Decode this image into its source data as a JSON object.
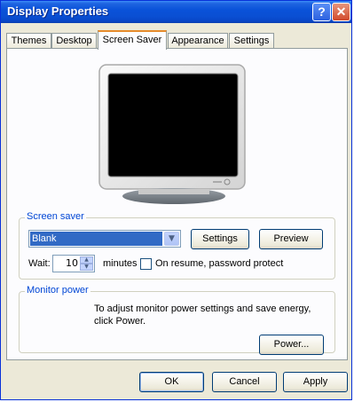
{
  "window": {
    "title": "Display Properties",
    "help_glyph": "?",
    "close_glyph": "✕"
  },
  "tabs": [
    {
      "label": "Themes"
    },
    {
      "label": "Desktop"
    },
    {
      "label": "Screen Saver"
    },
    {
      "label": "Appearance"
    },
    {
      "label": "Settings"
    }
  ],
  "active_tab": "Screen Saver",
  "screen_saver": {
    "group_label": "Screen saver",
    "selected": "Blank",
    "settings_label": "Settings",
    "preview_label": "Preview",
    "wait_label": "Wait:",
    "wait_value": "10",
    "minutes_label": "minutes",
    "resume_label": "On resume, password protect",
    "resume_checked": false
  },
  "monitor_power": {
    "group_label": "Monitor power",
    "description": "To adjust monitor power settings and save energy, click Power.",
    "power_label": "Power..."
  },
  "footer": {
    "ok_label": "OK",
    "cancel_label": "Cancel",
    "apply_label": "Apply"
  },
  "colors": {
    "titlebar": "#0a52d9",
    "selection": "#316ac5",
    "group_label": "#0046d5",
    "active_tab_accent": "#e68b2c"
  },
  "icons": {
    "help": "help-icon",
    "close": "close-icon",
    "monitor": "monitor-icon",
    "dropdown": "chevron-down-icon"
  }
}
